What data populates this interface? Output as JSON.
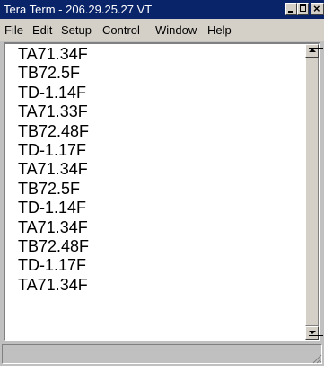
{
  "window": {
    "title": "Tera Term - 206.29.25.27 VT"
  },
  "menu": [
    "File",
    "Edit",
    "Setup",
    "Control",
    "Window",
    "Help"
  ],
  "terminal": {
    "lines": [
      "TA71.34F",
      "TB72.5F",
      "TD-1.14F",
      "TA71.33F",
      "TB72.48F",
      "TD-1.17F",
      "TA71.34F",
      "TB72.5F",
      "TD-1.14F",
      "TA71.34F",
      "TB72.48F",
      "TD-1.17F",
      "TA71.34F"
    ]
  },
  "icons": {
    "minimize": "minimize-icon",
    "maximize": "maximize-icon",
    "close": "close-icon",
    "scroll_up": "scroll-up-arrow-icon",
    "scroll_down": "scroll-down-arrow-icon",
    "resize_grip": "resize-grip-icon"
  },
  "colors": {
    "titlebar": "#0a246a",
    "chrome": "#d4d0c8",
    "terminal_bg": "#ffffff",
    "terminal_text": "#000000"
  }
}
